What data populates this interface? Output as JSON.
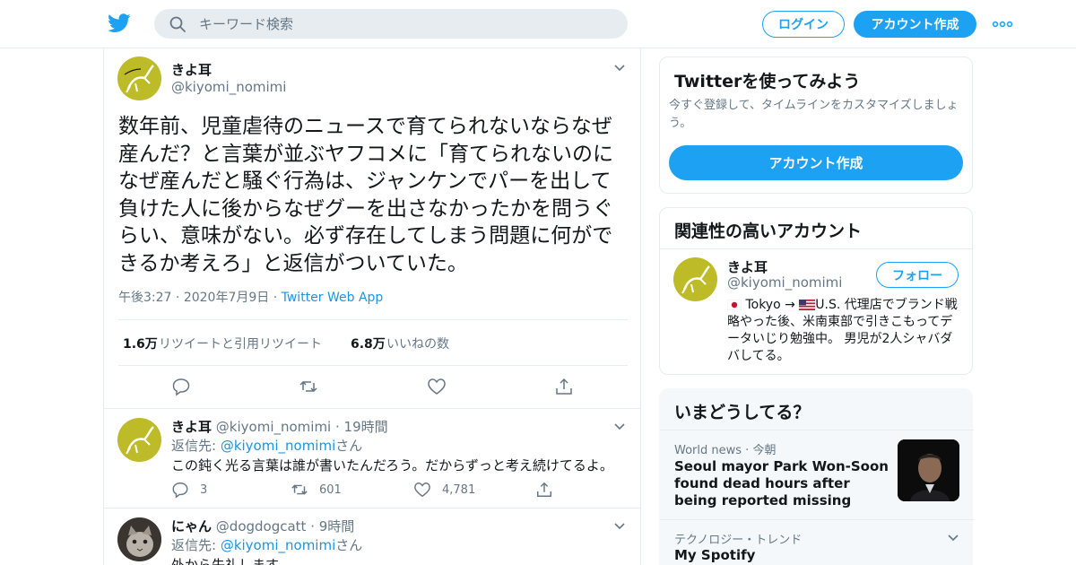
{
  "colors": {
    "accent": "#1da1f2",
    "link": "#1b95e0",
    "secondary_text": "#657786",
    "border": "#e6ecf0"
  },
  "header": {
    "logo": "twitter-bird-icon",
    "search_placeholder": "キーワード検索",
    "login_label": "ログイン",
    "signup_label": "アカウント作成",
    "more_icon": "more-dots-icon"
  },
  "tweet": {
    "name": "きよ耳",
    "handle": "@kiyomi_nomimi",
    "text": "数年前、児童虐待のニュースで育てられないならなぜ産んだ？と言葉が並ぶヤフコメに「育てられないのになぜ産んだと騒ぐ行為は、ジャンケンでパーを出して負けた人に後からなぜグーを出さなかったかを問うぐらい、意味がない。必ず存在してしまう問題に何ができるか考えろ」と返信がついていた。",
    "time": "午後3:27",
    "date": "2020年7月9日",
    "source": "Twitter Web App",
    "retweets_count": "1.6万",
    "retweets_label": "リツイートと引用リツイート",
    "likes_count": "6.8万",
    "likes_label": "いいねの数"
  },
  "replies": [
    {
      "name": "きよ耳",
      "handle": "@kiyomi_nomimi",
      "time": "19時間",
      "reply_to_label": "返信先: ",
      "reply_to_handle": "@kiyomi_nomimi",
      "reply_to_suffix": "さん",
      "text": "この鈍く光る言葉は誰が書いたんだろう。だからずっと考え続けてるよ。",
      "reply_count": "3",
      "retweet_count": "601",
      "like_count": "4,781"
    },
    {
      "name": "にゃん",
      "handle": "@dogdogcatt",
      "time": "9時間",
      "reply_to_label": "返信先: ",
      "reply_to_handle": "@kiyomi_nomimi",
      "reply_to_suffix": "さん",
      "text": "外から失礼します。"
    }
  ],
  "sidebar": {
    "try": {
      "title": "Twitterを使ってみよう",
      "desc": "今すぐ登録して、タイムラインをカスタマイズしましょう。",
      "button": "アカウント作成"
    },
    "related": {
      "title": "関連性の高いアカウント",
      "name": "きよ耳",
      "handle": "@kiyomi_nomimi",
      "follow": "フォロー",
      "bio_part1": "Tokyo →",
      "bio_part2": "U.S. 代理店でブランド戦略やった後、米南東部で引きこもってデータいじり勉強中。 男児が2人シャバダバしてる。"
    },
    "trends": {
      "title": "いまどうしてる？",
      "item1_category": "World news",
      "item1_time": "今朝",
      "item1_headline": "Seoul mayor Park Won-Soon found dead hours after being reported missing",
      "item2_category": "テクノロジー・トレンド",
      "item2_title": "My Spotify"
    }
  }
}
